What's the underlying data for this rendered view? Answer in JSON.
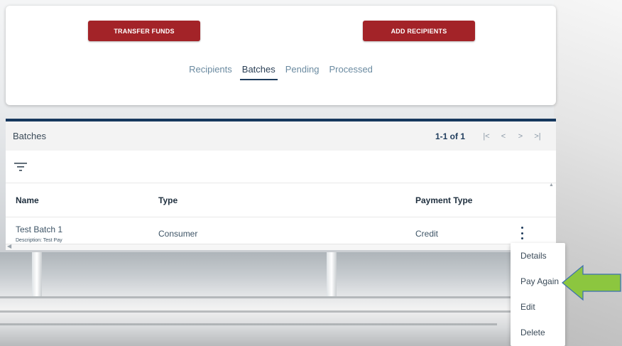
{
  "actions": {
    "transfer_funds": "TRANSFER FUNDS",
    "add_recipients": "ADD RECIPIENTS"
  },
  "tabs": [
    {
      "label": "Recipients",
      "active": false
    },
    {
      "label": "Batches",
      "active": true
    },
    {
      "label": "Pending",
      "active": false
    },
    {
      "label": "Processed",
      "active": false
    }
  ],
  "panel": {
    "title": "Batches",
    "pagination": {
      "range": "1-1 of 1",
      "first": "|<",
      "prev": "<",
      "next": ">",
      "last": ">|"
    },
    "filter_icon": "filter-icon",
    "columns": [
      "Name",
      "Type",
      "Payment Type"
    ],
    "rows": [
      {
        "name": "Test Batch 1",
        "description": "Description: Test Pay",
        "type": "Consumer",
        "payment_type": "Credit",
        "menu_icon": "more-vertical-icon"
      }
    ]
  },
  "context_menu": {
    "items": [
      "Details",
      "Pay Again",
      "Edit",
      "Delete"
    ]
  },
  "colors": {
    "button_red": "#a32328",
    "header_navy": "#16385e",
    "annotation_arrow": "#8cc63f"
  }
}
